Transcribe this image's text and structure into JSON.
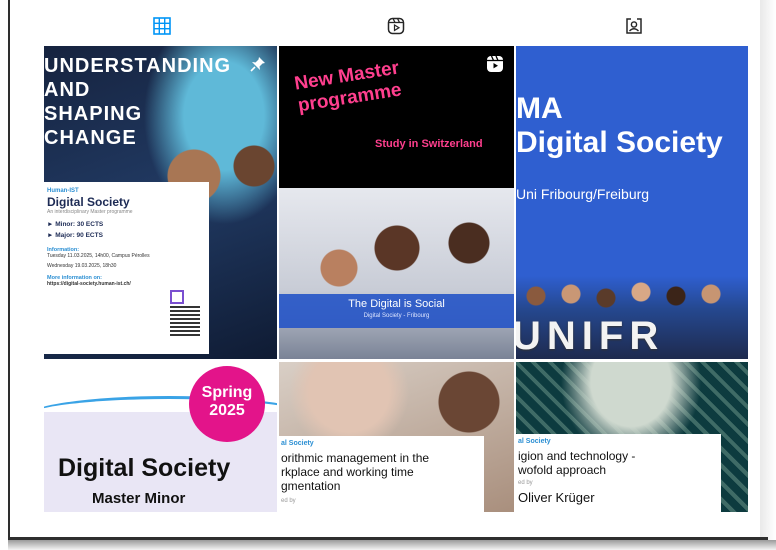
{
  "tabs": [
    {
      "name": "posts",
      "icon": "grid-icon",
      "active": true
    },
    {
      "name": "reels",
      "icon": "reels-icon",
      "active": false
    },
    {
      "name": "tagged",
      "icon": "tagged-icon",
      "active": false
    }
  ],
  "colors": {
    "accent": "#0095f6",
    "pink": "#ff3f8e",
    "magenta": "#e3148a",
    "blue": "#2f5fd0"
  },
  "posts": {
    "p1": {
      "headline": "UNDERSTANDING\nAND\nSHAPING\nCHANGE",
      "kicker": "Human-IST",
      "title": "Digital Society",
      "subtitle": "An interdisciplinary Master programme",
      "bullet1": "► Minor: 30 ECTS",
      "bullet2": "► Major: 90 ECTS",
      "info_label": "Information:",
      "info_line1": "Tuesday 11.03.2025, 14h00, Campus Pérolles",
      "info_line2": "Wednesday 19.03.2025, 18h30",
      "more_label": "More information on:",
      "more_url": "https://digital-society.human-ist.ch/"
    },
    "p2": {
      "headline": "New Master\nprogramme",
      "sub": "Study in Switzerland",
      "band_title": "The Digital is Social",
      "band_sub": "Digital Society - Fribourg"
    },
    "p3": {
      "line1": "MA",
      "line2": "Digital Society",
      "uni": "Uni Fribourg/Freiburg",
      "letters": "UNIFR"
    },
    "p4": {
      "badge": "Spring 2025",
      "title": "Digital Society",
      "subtitle": "Master Minor"
    },
    "p5": {
      "kicker": "al Society",
      "title": "orithmic management in the\nrkplace and working time\ngmentation",
      "by": "ed by"
    },
    "p6": {
      "kicker": "al Society",
      "title": "igion and technology -\nwofold approach",
      "by": "ed by",
      "author": "Oliver Krüger"
    }
  }
}
